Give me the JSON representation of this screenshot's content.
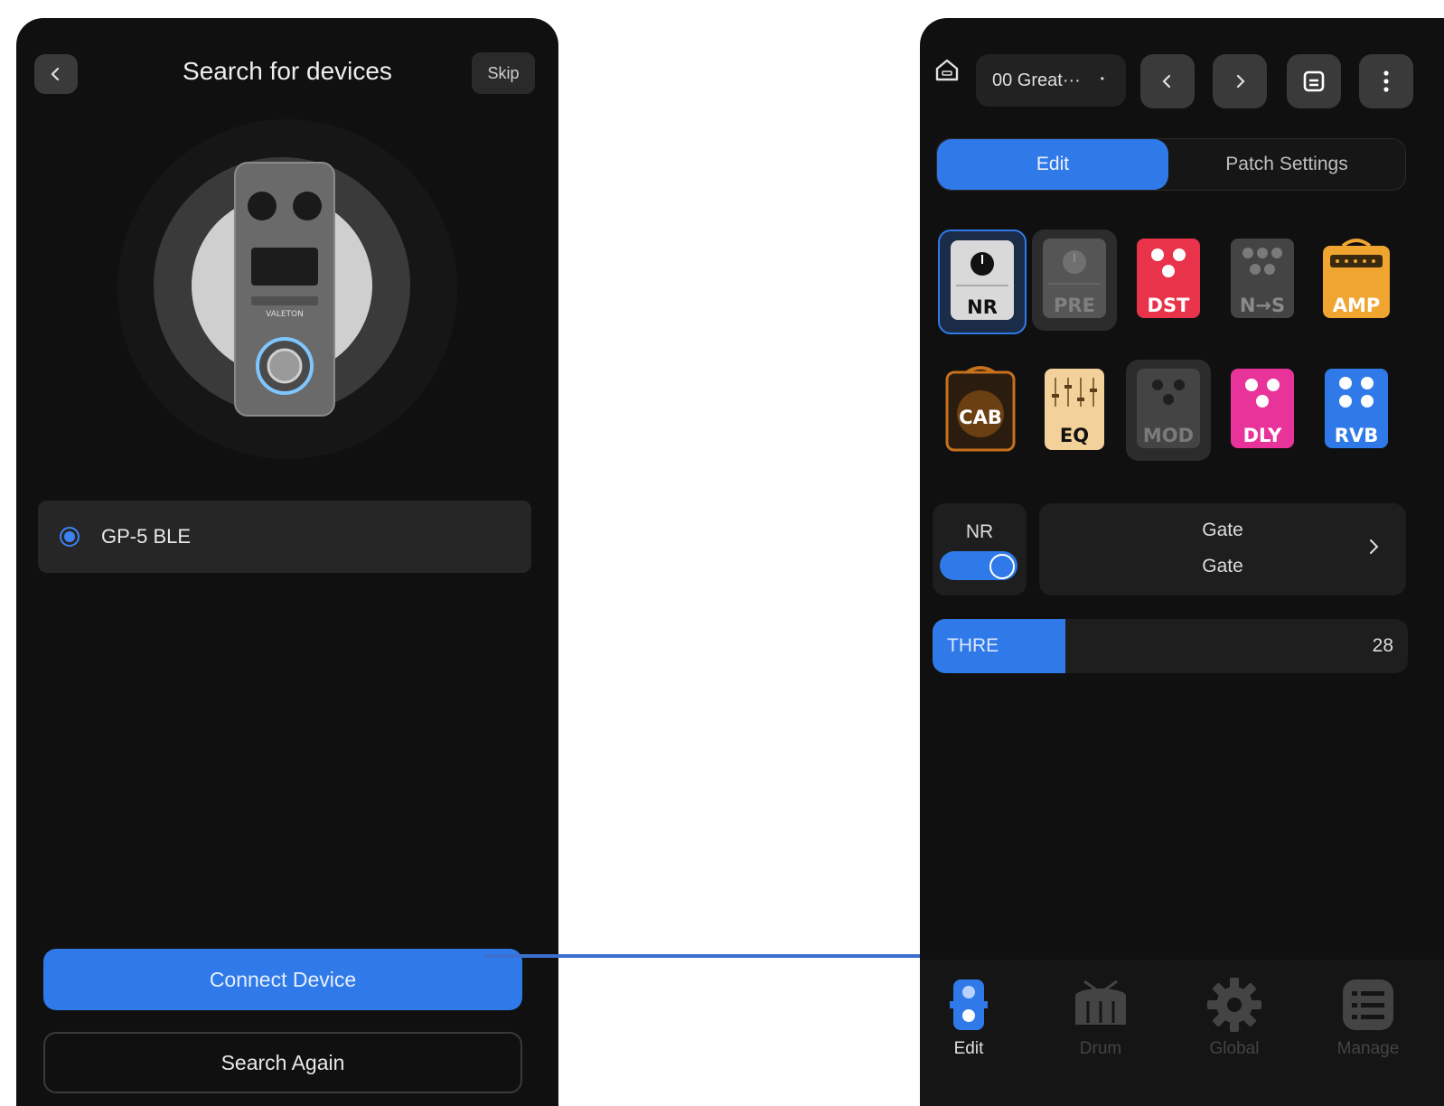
{
  "left_screen": {
    "title": "Search for devices",
    "skip_label": "Skip",
    "device_brand": "VALETON",
    "device_list": [
      {
        "name": "GP-5 BLE",
        "selected": true
      }
    ],
    "connect_label": "Connect Device",
    "search_again_label": "Search Again"
  },
  "right_screen": {
    "patch_name": "00 Great···",
    "patch_modified_marker": "•",
    "tabs": [
      "Edit",
      "Patch Settings"
    ],
    "active_tab": "Edit",
    "effect_blocks": [
      {
        "label": "NR",
        "icon": "noise-reduction-pedal-icon",
        "color": "#d9d9d9",
        "selected": true
      },
      {
        "label": "PRE",
        "icon": "preamp-pedal-icon",
        "color": "#5a5a5a",
        "selected": false
      },
      {
        "label": "DST",
        "icon": "distortion-pedal-icon",
        "color": "#e8334a",
        "selected": false
      },
      {
        "label": "N→S",
        "icon": "noise-suppressor-pedal-icon",
        "color": "#4a4a4a",
        "selected": false
      },
      {
        "label": "AMP",
        "icon": "amplifier-icon",
        "color": "#f0a530",
        "selected": false
      },
      {
        "label": "CAB",
        "icon": "cabinet-icon",
        "color": "#c7711c",
        "selected": false
      },
      {
        "label": "EQ",
        "icon": "equalizer-icon",
        "color": "#f2d29a",
        "selected": false
      },
      {
        "label": "MOD",
        "icon": "modulation-pedal-icon",
        "color": "#4a4a4a",
        "selected": false
      },
      {
        "label": "DLY",
        "icon": "delay-pedal-icon",
        "color": "#e8339a",
        "selected": false
      },
      {
        "label": "RVB",
        "icon": "reverb-pedal-icon",
        "color": "#2f7ae8",
        "selected": false
      }
    ],
    "module": {
      "name": "NR",
      "enabled": true,
      "type_line1": "Gate",
      "type_line2": "Gate"
    },
    "parameter": {
      "name": "THRE",
      "value": "28",
      "fill_fraction": 0.28
    },
    "bottom_nav": [
      {
        "label": "Edit",
        "icon": "pedal-icon",
        "active": true
      },
      {
        "label": "Drum",
        "icon": "drum-icon",
        "active": false
      },
      {
        "label": "Global",
        "icon": "gear-icon",
        "active": false
      },
      {
        "label": "Manage",
        "icon": "list-icon",
        "active": false
      }
    ]
  },
  "colors": {
    "accent": "#2f7ae8",
    "background": "#101010",
    "panel": "#1e1e1e",
    "inactive_nav": "#444444"
  }
}
